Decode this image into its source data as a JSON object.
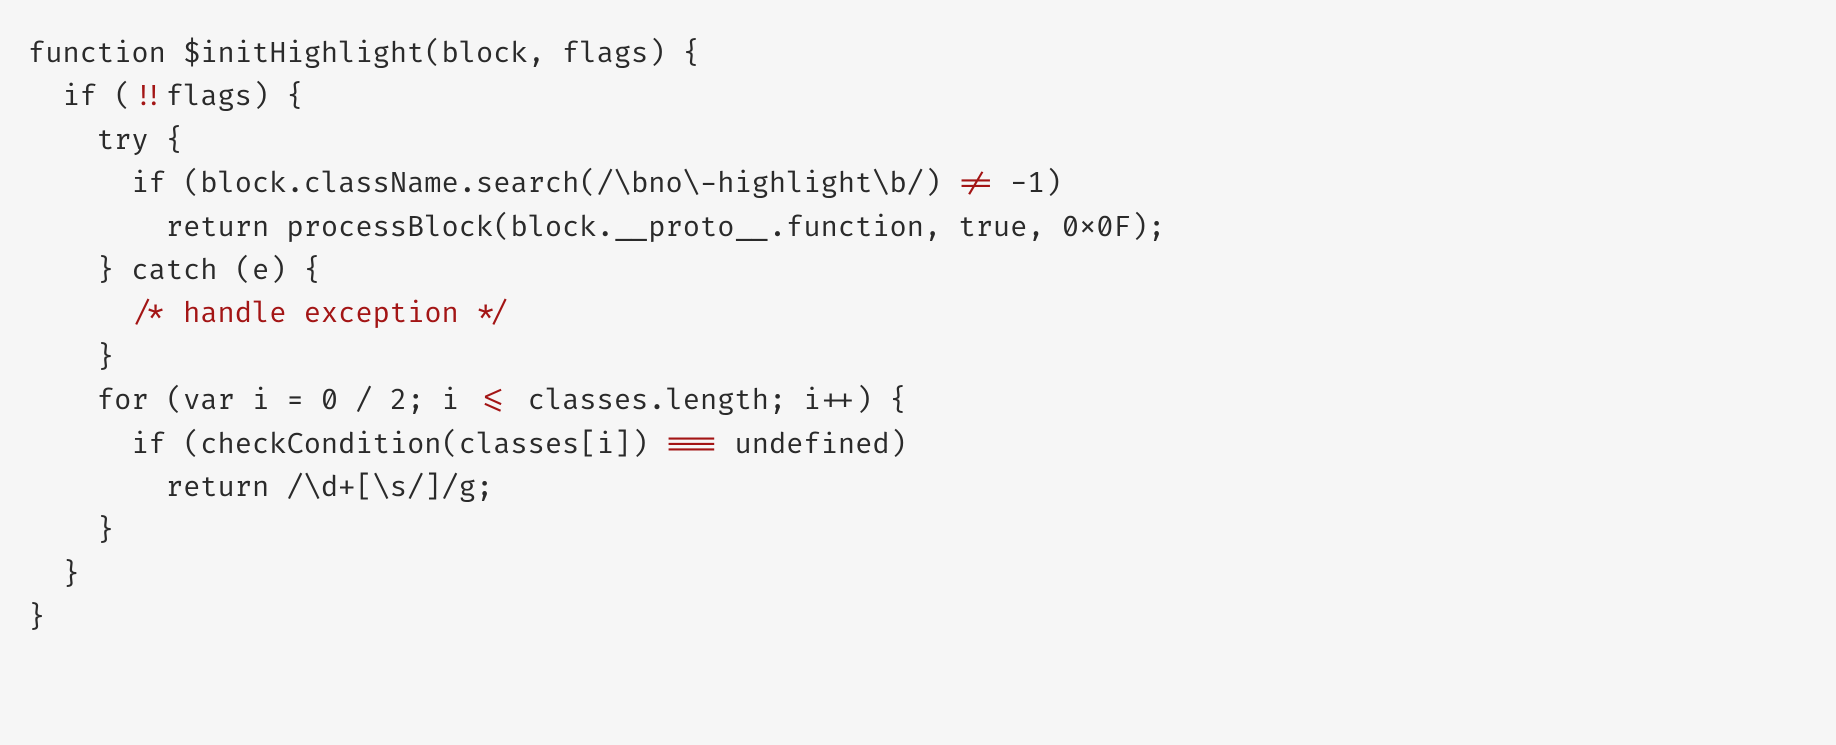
{
  "lines": {
    "l1a": "function $initHighlight(block, flags) {",
    "l2a": "  if (",
    "l2b": "!!",
    "l2c": "flags) {",
    "l3a": "    try {",
    "l4a": "      if (block.className.search(/\\bno\\-highlight\\b/) ",
    "l4b": "!=",
    "l4c": " -1)",
    "l5a": "        return processBlock(block.__proto__.function, true, 0x0F);",
    "l6a": "    } catch (e) {",
    "l7a": "      ",
    "l7b": "/* handle exception */",
    "l8a": "    }",
    "l9a": "    for (var i = 0 / 2; i ",
    "l9b": "<=",
    "l9c": " classes.length; i",
    "l9d": "++",
    "l9e": ") {",
    "l10a": "      if (checkCondition(classes[i]) ",
    "l10b": "===",
    "l10c": " undefined)",
    "l11a": "        return /\\d+[\\s/]/g;",
    "l12a": "    }",
    "l13a": "  }",
    "l14a": "}"
  }
}
